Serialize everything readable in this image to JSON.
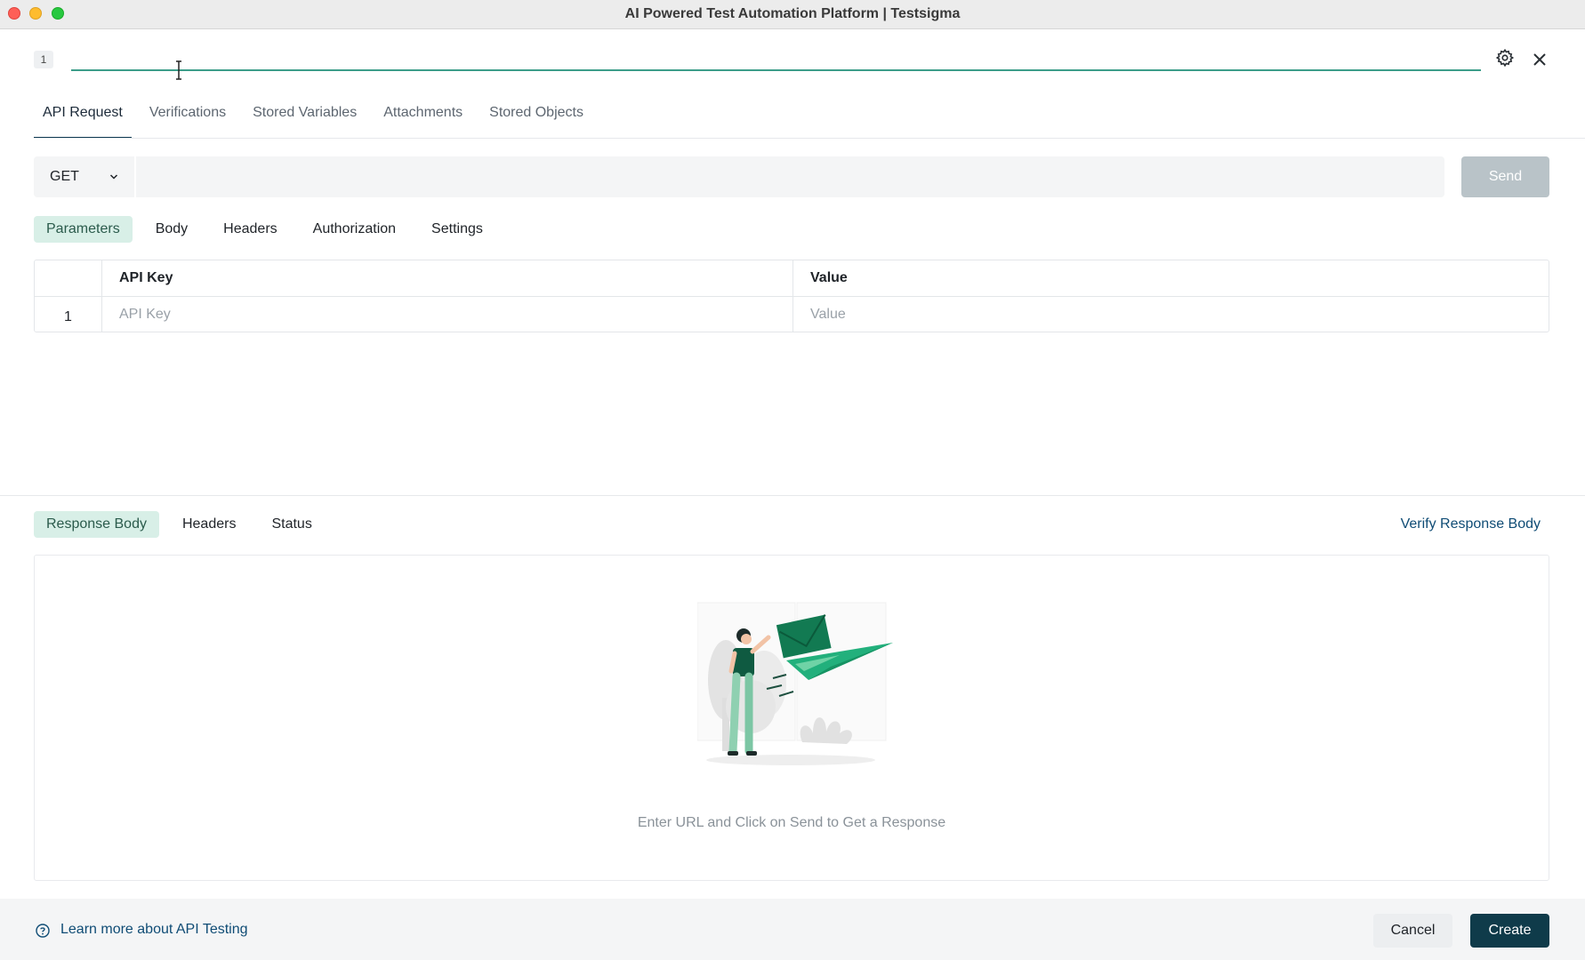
{
  "window": {
    "title": "AI Powered Test Automation Platform | Testsigma"
  },
  "step": {
    "number": "1",
    "name_value": "",
    "name_placeholder": ""
  },
  "main_tabs": [
    {
      "label": "API Request",
      "active": true
    },
    {
      "label": "Verifications",
      "active": false
    },
    {
      "label": "Stored Variables",
      "active": false
    },
    {
      "label": "Attachments",
      "active": false
    },
    {
      "label": "Stored Objects",
      "active": false
    }
  ],
  "request": {
    "method": "GET",
    "url_value": "",
    "send_label": "Send"
  },
  "request_tabs": [
    {
      "label": "Parameters",
      "active": true
    },
    {
      "label": "Body",
      "active": false
    },
    {
      "label": "Headers",
      "active": false
    },
    {
      "label": "Authorization",
      "active": false
    },
    {
      "label": "Settings",
      "active": false
    }
  ],
  "params_table": {
    "headers": {
      "key": "API Key",
      "value": "Value"
    },
    "rows": [
      {
        "index": "1",
        "key_placeholder": "API Key",
        "value_placeholder": "Value"
      }
    ]
  },
  "response": {
    "tabs": [
      {
        "label": "Response Body",
        "active": true
      },
      {
        "label": "Headers",
        "active": false
      },
      {
        "label": "Status",
        "active": false
      }
    ],
    "verify_label": "Verify Response Body",
    "empty_message": "Enter URL and Click on Send to Get a Response"
  },
  "footer": {
    "learn_more_label": "Learn more about API Testing",
    "cancel_label": "Cancel",
    "create_label": "Create"
  },
  "colors": {
    "accent": "#3c9d89",
    "primary_dark": "#0f3b4a",
    "link": "#0f4c75",
    "active_tab_bg": "#d8efe7",
    "illustration_green": "#1a9a6c"
  }
}
